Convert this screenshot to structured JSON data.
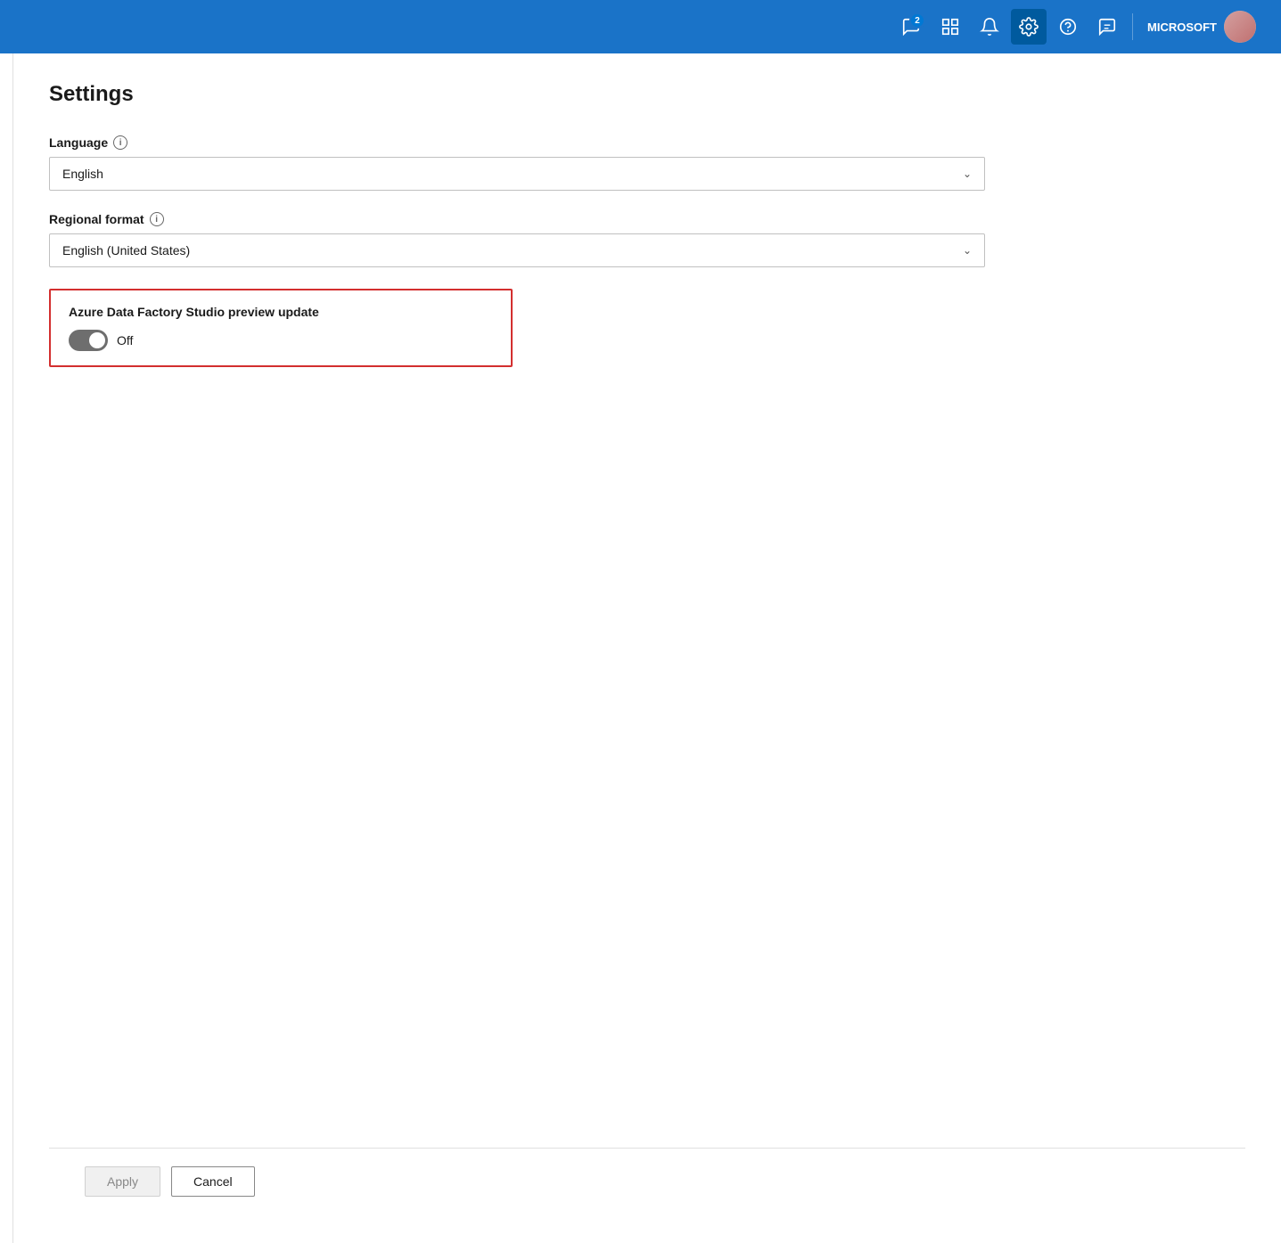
{
  "topbar": {
    "notifications_badge": "2",
    "username": "MICROSOFT",
    "icons": [
      {
        "name": "chat-icon",
        "label": "Chat"
      },
      {
        "name": "grid-icon",
        "label": "Grid"
      },
      {
        "name": "bell-icon",
        "label": "Notifications"
      },
      {
        "name": "gear-icon",
        "label": "Settings"
      },
      {
        "name": "help-icon",
        "label": "Help"
      },
      {
        "name": "user-icon",
        "label": "User"
      }
    ]
  },
  "settings": {
    "title": "Settings",
    "language": {
      "label": "Language",
      "value": "English",
      "info": "i"
    },
    "regional_format": {
      "label": "Regional format",
      "value": "English (United States)",
      "info": "i"
    },
    "preview_update": {
      "label": "Azure Data Factory Studio preview update",
      "toggle_state": false,
      "toggle_text": "Off"
    }
  },
  "footer": {
    "apply_label": "Apply",
    "cancel_label": "Cancel"
  }
}
